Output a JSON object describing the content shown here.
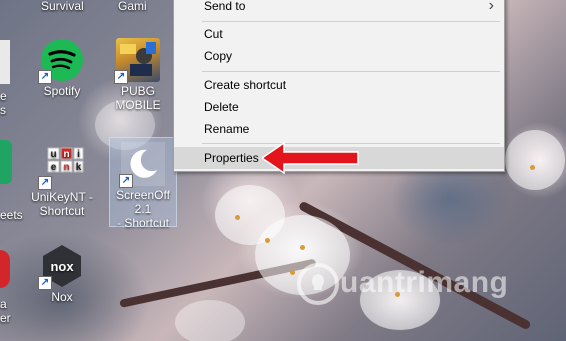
{
  "desktop_icons": {
    "survival_label": "Survival",
    "gaming_label": "Gami",
    "spotify_label": "Spotify",
    "pubg_label": "PUBG\nMOBILE",
    "unikey_label": "UniKeyNT -\nShortcut",
    "screenoff_label": "ScreenOff 2.1\n- Shortcut",
    "nox_label": "Nox",
    "nox_logo_text": "nox",
    "left_partial_1": "e",
    "left_partial_2": "s",
    "left_partial_3": "eets",
    "left_partial_4": "a",
    "left_partial_5": "er",
    "unikey_tile_letters": [
      "u",
      "n",
      "i",
      "e",
      "n",
      "k"
    ]
  },
  "context_menu": {
    "send_to_label": "Send to",
    "cut_label": "Cut",
    "copy_label": "Copy",
    "create_shortcut_label": "Create shortcut",
    "delete_label": "Delete",
    "rename_label": "Rename",
    "properties_label": "Properties",
    "submenu_chevron": "›"
  },
  "watermark": {
    "text": "uantrimang"
  },
  "colors": {
    "menu_bg": "#f2f2f2",
    "menu_highlight": "#d8d8d8",
    "arrow_red": "#e3141b",
    "spotify_green": "#1db954",
    "nox_dark": "#2f3136"
  }
}
